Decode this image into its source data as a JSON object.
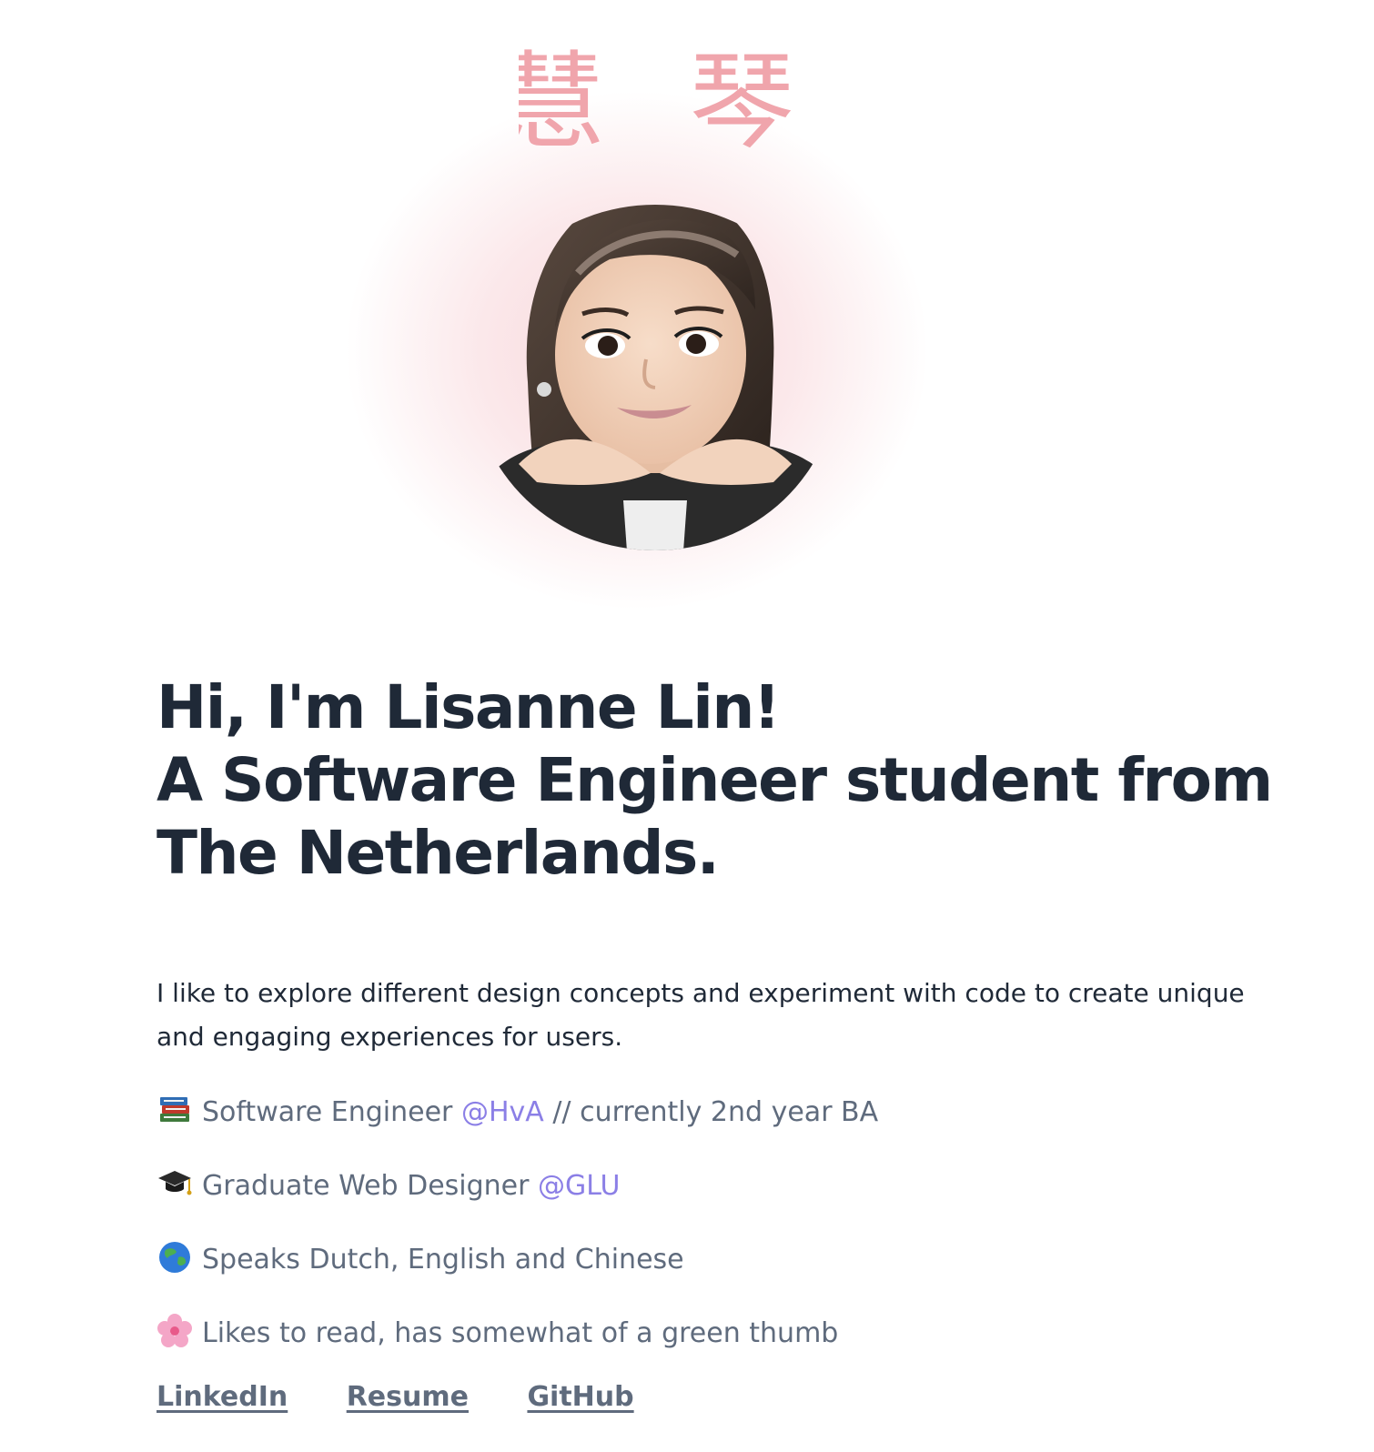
{
  "hero": {
    "calligraphy": "慧 琴",
    "accent_pink": "#f0a5ac",
    "avatar_icon": "memoji-avatar"
  },
  "headline": {
    "line1": "Hi, I'm Lisanne Lin!",
    "line2": "A Software Engineer student from",
    "line3": "The Netherlands."
  },
  "intro": "I like to explore different design concepts and experiment with code to create unique and engaging experiences for users.",
  "facts": [
    {
      "icon": "books-icon",
      "text_before": "Software Engineer ",
      "mention": "@HvA",
      "text_after": " // currently 2nd year BA"
    },
    {
      "icon": "graduation-cap-icon",
      "text_before": "Graduate Web Designer ",
      "mention": "@GLU",
      "text_after": ""
    },
    {
      "icon": "globe-icon",
      "text_before": "Speaks Dutch, English and Chinese",
      "mention": "",
      "text_after": ""
    },
    {
      "icon": "cherry-blossom-icon",
      "text_before": "Likes to read, has somewhat of a green thumb",
      "mention": "",
      "text_after": ""
    }
  ],
  "links": {
    "linkedin": "LinkedIn",
    "resume": "Resume",
    "github": "GitHub"
  },
  "colors": {
    "heading": "#1f2937",
    "body_muted": "#5f6b7d",
    "mention": "#8b7fe6"
  }
}
